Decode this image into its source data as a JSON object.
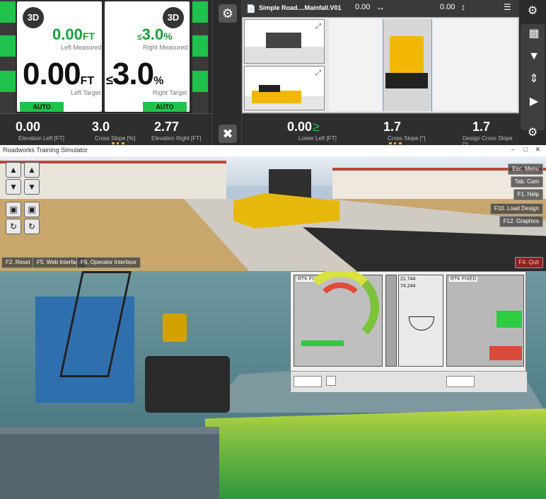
{
  "left_gauge": {
    "badge": "3D",
    "measured_value": "0.00",
    "measured_unit": "FT",
    "measured_caption": "Left Measured",
    "target_value": "0.00",
    "target_unit": "FT",
    "target_caption": "Left Target",
    "mode": "AUTO"
  },
  "right_gauge": {
    "badge": "3D",
    "measured_value": "3.0",
    "measured_unit": "%",
    "measured_caption": "Right Measured",
    "target_value": "3.0",
    "target_unit": "%",
    "target_caption": "Right Target",
    "mode": "AUTO"
  },
  "left_bottom": [
    {
      "value": "0.00",
      "caption": "Elevation Left [FT]"
    },
    {
      "value": "3.0",
      "caption": "Cross Slope [%]"
    },
    {
      "value": "2.77",
      "caption": "Elevation Right [FT]"
    }
  ],
  "project": {
    "name": "Simple Road....Mainfall.V01",
    "offset_h": "0.00",
    "offset_v": "0.00"
  },
  "right_bottom": [
    {
      "value": "0.00",
      "caption": "Lower Left [FT]"
    },
    {
      "value": "1.7",
      "caption": "Cross Slope [°]"
    },
    {
      "value": "1.7",
      "caption": "Design Cross Slope [°]"
    }
  ],
  "simulator": {
    "window_title": "Roadworks Training Simulator",
    "buttons_right": [
      "Esc. Menu",
      "Tab. Cam",
      "F1. Help",
      "F10. Load Design",
      "F12. Graphics"
    ],
    "buttons_bottom": [
      "F2. Reset",
      "F5. Web Interface",
      "F6. Operator Interface"
    ],
    "quit_label": "F4. Quit"
  },
  "dredge": {
    "panel_labels": [
      "RTK FIXED",
      "RTK FIXED"
    ],
    "readouts": [
      "21.744",
      "74.244"
    ]
  },
  "colors": {
    "accent_green": "#1fc24a",
    "paver_yellow": "#f2b705",
    "panel_dark": "#2b2b2b"
  }
}
